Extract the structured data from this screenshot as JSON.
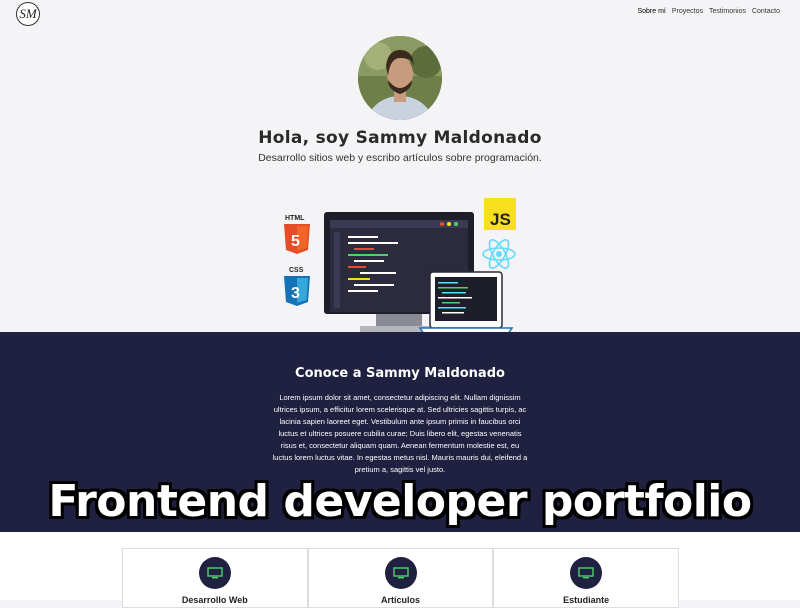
{
  "logo": {
    "text": "SM"
  },
  "nav": {
    "items": [
      "Sobre mí",
      "Proyectos",
      "Testimonios",
      "Contacto"
    ]
  },
  "hero": {
    "title": "Hola, soy Sammy Maldonado",
    "subtitle": "Desarrollo sitios web y escribo artículos sobre programación."
  },
  "tech_badges": {
    "html": "HTML",
    "css": "CSS",
    "js": "JS"
  },
  "about": {
    "title": "Conoce a Sammy Maldonado",
    "text": "Lorem ipsum dolor sit amet, consectetur adipiscing elit. Nullam dignissim ultrices ipsum, a efficitur lorem scelerisque at. Sed ultricies sagittis turpis, ac lacinia sapien laoreet eget. Vestibulum ante ipsum primis in faucibus orci luctus et ultrices posuere cubilia curae; Duis libero elit, egestas venenatis risus et, consectetur aliquam quam. Aenean fermentum molestie est, eu luctus lorem luctus vitae. In egestas metus nisl. Mauris mauris dui, eleifend a pretium a, sagittis vel justo."
  },
  "overlay_caption": "Frontend developer portfolio",
  "services": [
    {
      "label": "Desarrollo Web"
    },
    {
      "label": "Artículos"
    },
    {
      "label": "Estudiante"
    }
  ],
  "colors": {
    "dark_navy": "#202040",
    "accent_green": "#4dd26b",
    "js_yellow": "#f7df1e",
    "html_orange": "#e44d26",
    "css_blue": "#1572b6",
    "react_cyan": "#61dafb"
  }
}
